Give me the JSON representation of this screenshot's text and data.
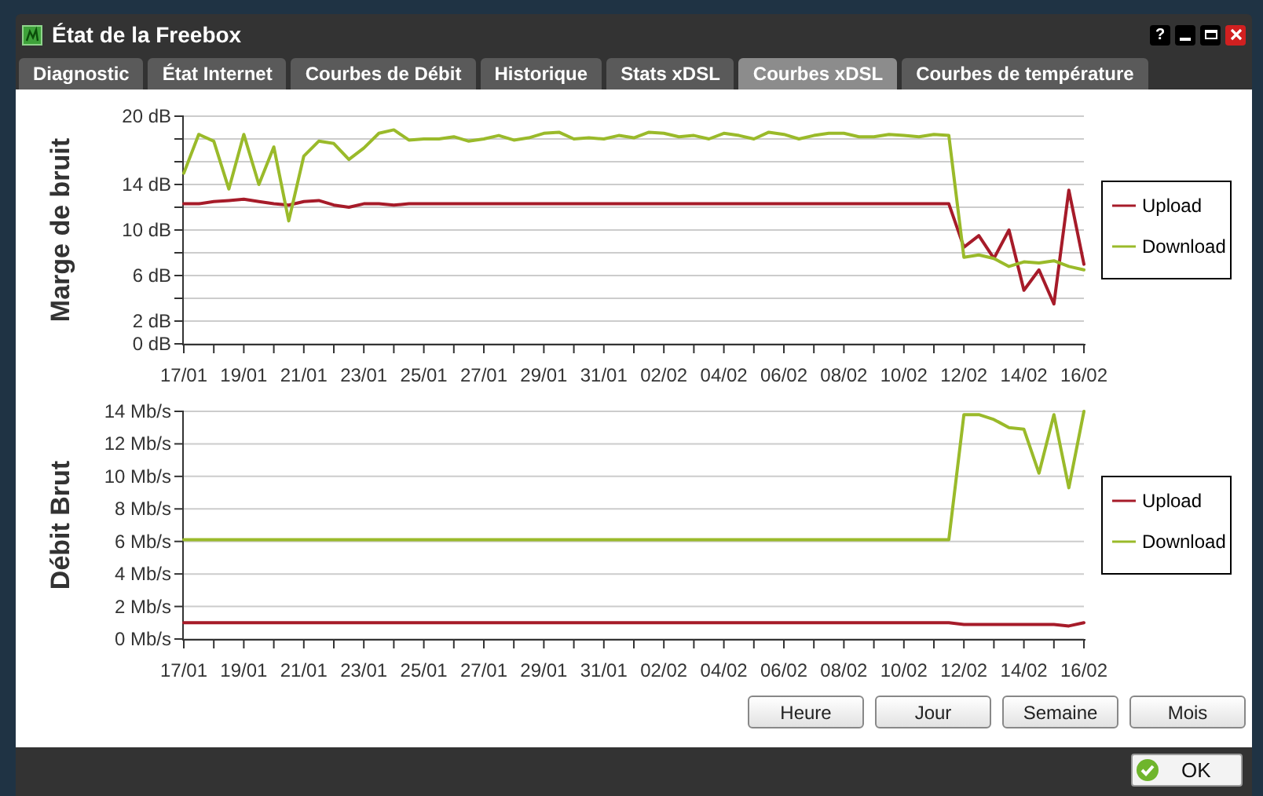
{
  "window": {
    "title": "État de la Freebox",
    "help_label": "?"
  },
  "tabs": [
    {
      "label": "Diagnostic",
      "selected": false
    },
    {
      "label": "État Internet",
      "selected": false
    },
    {
      "label": "Courbes de Débit",
      "selected": false
    },
    {
      "label": "Historique",
      "selected": false
    },
    {
      "label": "Stats xDSL",
      "selected": false
    },
    {
      "label": "Courbes xDSL",
      "selected": true
    },
    {
      "label": "Courbes de température",
      "selected": false
    }
  ],
  "charts": [
    {
      "chart_data": {
        "type": "line",
        "ylabel": "Marge de bruit",
        "ylim": [
          0,
          20
        ],
        "grid": true,
        "legend": "right",
        "categories": [
          "17/01",
          null,
          null,
          null,
          "19/01",
          null,
          null,
          null,
          "21/01",
          null,
          null,
          null,
          "23/01",
          null,
          null,
          null,
          "25/01",
          null,
          null,
          null,
          "27/01",
          null,
          null,
          null,
          "29/01",
          null,
          null,
          null,
          "31/01",
          null,
          null,
          null,
          "02/02",
          null,
          null,
          null,
          "04/02",
          null,
          null,
          null,
          "06/02",
          null,
          null,
          null,
          "08/02",
          null,
          null,
          null,
          "10/02",
          null,
          null,
          null,
          "12/02",
          null,
          null,
          null,
          "14/02",
          null,
          null,
          null,
          "16/02"
        ],
        "yticks": [
          {
            "value": 0,
            "label": "0 dB"
          },
          {
            "value": 2,
            "label": "2 dB"
          },
          {
            "value": 6,
            "label": "6 dB"
          },
          {
            "value": 10,
            "label": "10 dB"
          },
          {
            "value": 14,
            "label": "14 dB"
          },
          {
            "value": 20,
            "label": "20 dB"
          }
        ],
        "series": [
          {
            "name": "Upload",
            "color": "#a61b29",
            "values": [
              12.3,
              12.3,
              12.5,
              12.6,
              12.7,
              12.5,
              12.3,
              12.2,
              12.5,
              12.6,
              12.2,
              12,
              12.3,
              12.3,
              12.2,
              12.3,
              12.3,
              12.3,
              12.3,
              12.3,
              12.3,
              12.3,
              12.3,
              12.3,
              12.3,
              12.3,
              12.3,
              12.3,
              12.3,
              12.3,
              12.3,
              12.3,
              12.3,
              12.3,
              12.3,
              12.3,
              12.3,
              12.3,
              12.3,
              12.3,
              12.3,
              12.3,
              12.3,
              12.3,
              12.3,
              12.3,
              12.3,
              12.3,
              12.3,
              12.3,
              12.3,
              12.3,
              8.5,
              9.5,
              7.5,
              10,
              4.7,
              6.5,
              3.5,
              13.5,
              7
            ]
          },
          {
            "name": "Download",
            "color": "#9aba2a",
            "values": [
              15,
              18.4,
              17.8,
              13.6,
              18.4,
              14,
              17.3,
              10.8,
              16.5,
              17.8,
              17.6,
              16.2,
              17.2,
              18.5,
              18.8,
              17.9,
              18,
              18,
              18.2,
              17.8,
              18,
              18.3,
              17.9,
              18.1,
              18.5,
              18.6,
              18,
              18.1,
              18,
              18.3,
              18.1,
              18.6,
              18.5,
              18.2,
              18.3,
              18,
              18.5,
              18.3,
              18,
              18.6,
              18.4,
              18,
              18.3,
              18.5,
              18.5,
              18.2,
              18.2,
              18.4,
              18.3,
              18.2,
              18.4,
              18.3,
              7.6,
              7.8,
              7.5,
              6.8,
              7.2,
              7.1,
              7.3,
              6.8,
              6.5
            ]
          }
        ]
      }
    },
    {
      "chart_data": {
        "type": "line",
        "ylabel": "Débit Brut",
        "ylim": [
          0,
          14
        ],
        "grid": true,
        "legend": "right",
        "categories": [
          "17/01",
          null,
          null,
          null,
          "19/01",
          null,
          null,
          null,
          "21/01",
          null,
          null,
          null,
          "23/01",
          null,
          null,
          null,
          "25/01",
          null,
          null,
          null,
          "27/01",
          null,
          null,
          null,
          "29/01",
          null,
          null,
          null,
          "31/01",
          null,
          null,
          null,
          "02/02",
          null,
          null,
          null,
          "04/02",
          null,
          null,
          null,
          "06/02",
          null,
          null,
          null,
          "08/02",
          null,
          null,
          null,
          "10/02",
          null,
          null,
          null,
          "12/02",
          null,
          null,
          null,
          "14/02",
          null,
          null,
          null,
          "16/02"
        ],
        "yticks": [
          {
            "value": 0,
            "label": "0 Mb/s"
          },
          {
            "value": 2,
            "label": "2 Mb/s"
          },
          {
            "value": 4,
            "label": "4 Mb/s"
          },
          {
            "value": 6,
            "label": "6 Mb/s"
          },
          {
            "value": 8,
            "label": "8 Mb/s"
          },
          {
            "value": 10,
            "label": "10 Mb/s"
          },
          {
            "value": 12,
            "label": "12 Mb/s"
          },
          {
            "value": 14,
            "label": "14 Mb/s"
          }
        ],
        "series": [
          {
            "name": "Upload",
            "color": "#a61b29",
            "values": [
              1,
              1,
              1,
              1,
              1,
              1,
              1,
              1,
              1,
              1,
              1,
              1,
              1,
              1,
              1,
              1,
              1,
              1,
              1,
              1,
              1,
              1,
              1,
              1,
              1,
              1,
              1,
              1,
              1,
              1,
              1,
              1,
              1,
              1,
              1,
              1,
              1,
              1,
              1,
              1,
              1,
              1,
              1,
              1,
              1,
              1,
              1,
              1,
              1,
              1,
              1,
              1,
              0.9,
              0.9,
              0.9,
              0.9,
              0.9,
              0.9,
              0.9,
              0.8,
              1
            ]
          },
          {
            "name": "Download",
            "color": "#9aba2a",
            "values": [
              6.1,
              6.1,
              6.1,
              6.1,
              6.1,
              6.1,
              6.1,
              6.1,
              6.1,
              6.1,
              6.1,
              6.1,
              6.1,
              6.1,
              6.1,
              6.1,
              6.1,
              6.1,
              6.1,
              6.1,
              6.1,
              6.1,
              6.1,
              6.1,
              6.1,
              6.1,
              6.1,
              6.1,
              6.1,
              6.1,
              6.1,
              6.1,
              6.1,
              6.1,
              6.1,
              6.1,
              6.1,
              6.1,
              6.1,
              6.1,
              6.1,
              6.1,
              6.1,
              6.1,
              6.1,
              6.1,
              6.1,
              6.1,
              6.1,
              6.1,
              6.1,
              6.1,
              13.8,
              13.8,
              13.5,
              13,
              12.9,
              10.2,
              13.8,
              9.3,
              14
            ]
          }
        ]
      }
    }
  ],
  "range_buttons": [
    {
      "label": "Heure"
    },
    {
      "label": "Jour"
    },
    {
      "label": "Semaine"
    },
    {
      "label": "Mois"
    }
  ],
  "ok_button": {
    "label": "OK"
  }
}
